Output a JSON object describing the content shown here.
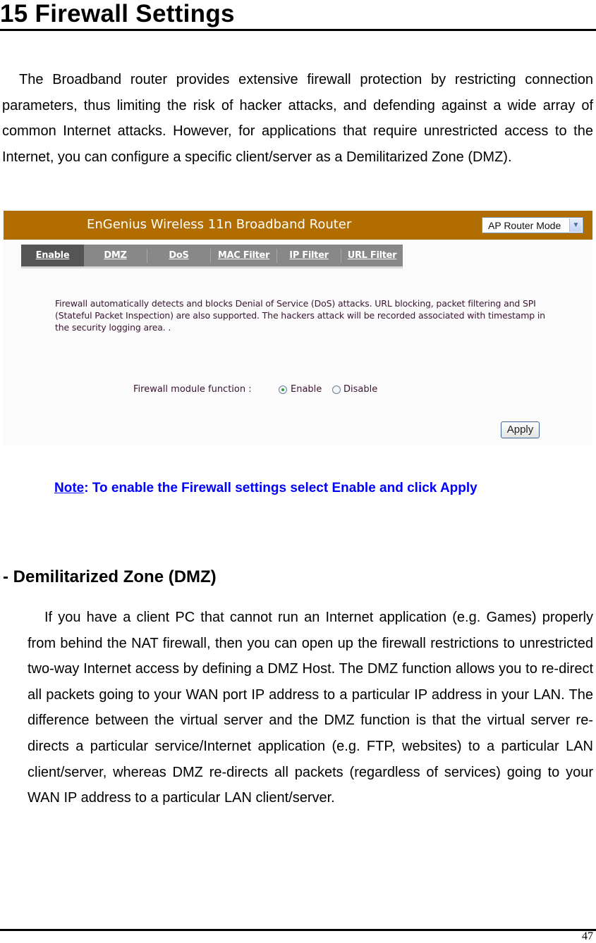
{
  "chapter": {
    "number": "15",
    "title": "15  Firewall Settings"
  },
  "intro_paragraph": "The Broadband router provides extensive firewall protection by restricting connection parameters, thus limiting the risk of hacker attacks, and defending against a wide array of common Internet attacks. However, for applications that require unrestricted access to the Internet, you can configure a specific client/server as a Demilitarized Zone (DMZ).",
  "router_ui": {
    "header_title": "EnGenius Wireless 11n Broadband Router",
    "header_color": "#b26d00",
    "mode_select": {
      "value": "AP Router Mode",
      "arrow_icon": "chevron-down-icon"
    },
    "tabs": [
      {
        "label": "Enable",
        "active": true
      },
      {
        "label": "DMZ",
        "active": false
      },
      {
        "label": "DoS",
        "active": false
      },
      {
        "label": "MAC Filter",
        "active": false
      },
      {
        "label": "IP Filter",
        "active": false
      },
      {
        "label": "URL Filter",
        "active": false
      }
    ],
    "description": "Firewall automatically detects and blocks Denial of Service (DoS) attacks. URL blocking, packet filtering and SPI (Stateful Packet Inspection) are also supported. The hackers attack will be recorded associated with timestamp in the security logging area. .",
    "firewall_module": {
      "label": "Firewall module function :",
      "options": [
        {
          "label": "Enable",
          "selected": true
        },
        {
          "label": "Disable",
          "selected": false
        }
      ]
    },
    "apply_label": "Apply"
  },
  "note": {
    "keyword": "Note",
    "text": ": To enable the Firewall settings select Enable and click Apply",
    "color": "#0000ff"
  },
  "dmz_section": {
    "heading": "- Demilitarized Zone (DMZ)",
    "paragraph": "If you have a client PC that cannot run an Internet application (e.g. Games) properly from behind the NAT firewall, then you can open up the firewall restrictions to unrestricted two-way Internet access by defining a DMZ Host. The DMZ function allows you to re-direct all packets going to your WAN port IP address to a particular IP address in your LAN. The difference between the virtual server and the DMZ function is that the virtual server re-directs a particular service/Internet application (e.g. FTP, websites) to a particular LAN client/server, whereas DMZ re-directs all packets (regardless of services) going to your WAN IP address to a particular LAN client/server."
  },
  "footer": {
    "page_number": "47"
  }
}
